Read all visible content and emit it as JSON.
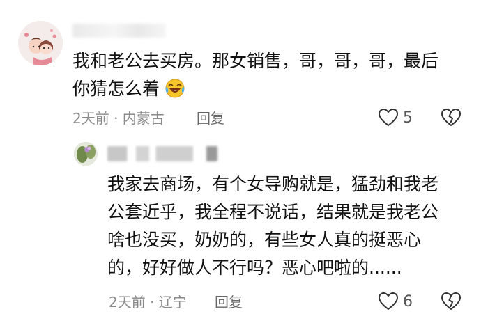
{
  "comment": {
    "username_redacted": true,
    "text_line1": "我和老公去买房。那女销售，哥，哥，哥，最后",
    "text_line2": "你猜怎么着",
    "emoji": "crying-laughing-emoji",
    "meta": "2天前 · 内蒙古",
    "reply_label": "回复",
    "like_count": "5"
  },
  "reply": {
    "username_redacted": true,
    "lines": [
      "我家去商场，有个女导购就是，猛劲和我老",
      "公套近乎，我全程不说话，结果就是我老公",
      "啥也没买，奶奶的，有些女人真的挺恶心",
      "的，好好做人不行吗？恶心吧啦的......"
    ],
    "meta": "2天前 · 辽宁",
    "reply_label": "回复",
    "like_count": "6"
  },
  "colors": {
    "text": "#111111",
    "meta": "#8a8a8a",
    "icon": "#333333"
  }
}
